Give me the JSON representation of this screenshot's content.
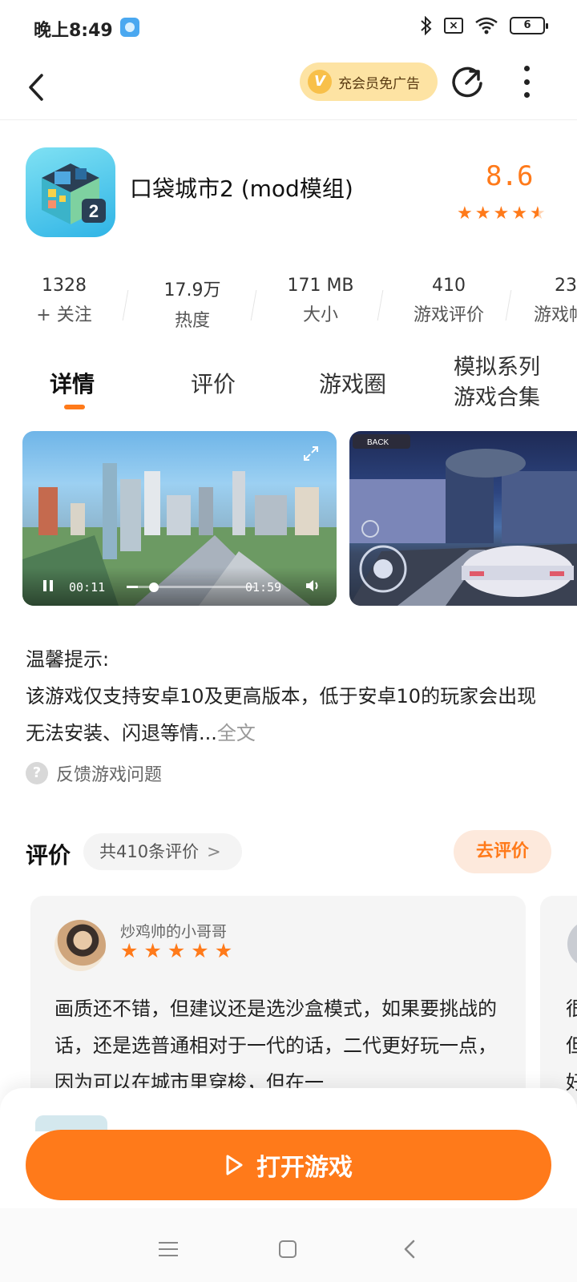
{
  "status_bar": {
    "time": "晚上8:49",
    "battery": "6",
    "icons": [
      "app-notification-icon",
      "bluetooth-icon",
      "no-sim-icon",
      "wifi-icon",
      "battery-icon"
    ]
  },
  "top_nav": {
    "back_icon": "back-chevron-icon",
    "vip_badge": "V",
    "vip_label": "充会员免广告",
    "share_icon": "share-icon",
    "more_icon": "more-vertical-icon"
  },
  "app": {
    "title": "口袋城市2 (mod模组)",
    "rating": "8.6",
    "stars": 4.5,
    "icon_digit": "2"
  },
  "stats": [
    {
      "value": "1328",
      "label": "+ 关注"
    },
    {
      "value": "17.9万",
      "label": "热度"
    },
    {
      "value": "171 MB",
      "label": "大小"
    },
    {
      "value": "410",
      "label": "游戏评价"
    },
    {
      "value": "23",
      "label": "游戏帖"
    }
  ],
  "tabs": [
    {
      "label": "详情",
      "active": true
    },
    {
      "label": "评价"
    },
    {
      "label": "游戏圈"
    },
    {
      "label_line1": "模拟系列",
      "label_line2": "游戏合集"
    }
  ],
  "video": {
    "current": "00:11",
    "total": "01:59",
    "progress": 0.09
  },
  "screenshot": {
    "hud_text": "BACK"
  },
  "tip": {
    "heading": "温馨提示:",
    "body": "该游戏仅支持安卓10及更高版本，低于安卓10的玩家会出现无法安装、闪退等情...",
    "more": "全文"
  },
  "feedback": {
    "icon": "?",
    "label": "反馈游戏问题"
  },
  "reviews": {
    "title": "评价",
    "count_label": "共410条评价",
    "count_chevron": ">",
    "write_label": "去评价",
    "items": [
      {
        "user": "炒鸡帅的小哥哥",
        "stars": 5,
        "text": "画质还不错，但建议还是选沙盒模式，如果要挑战的话，还是选普通相对于一代的话，二代更好玩一点，因为可以在城市里穿梭，但在一"
      },
      {
        "user": "",
        "text": "很但好"
      }
    ]
  },
  "action": {
    "open_label": "打开游戏"
  },
  "system_nav": {
    "menu_icon": "menu-icon",
    "home_icon": "home-icon",
    "back_icon": "back-icon"
  }
}
